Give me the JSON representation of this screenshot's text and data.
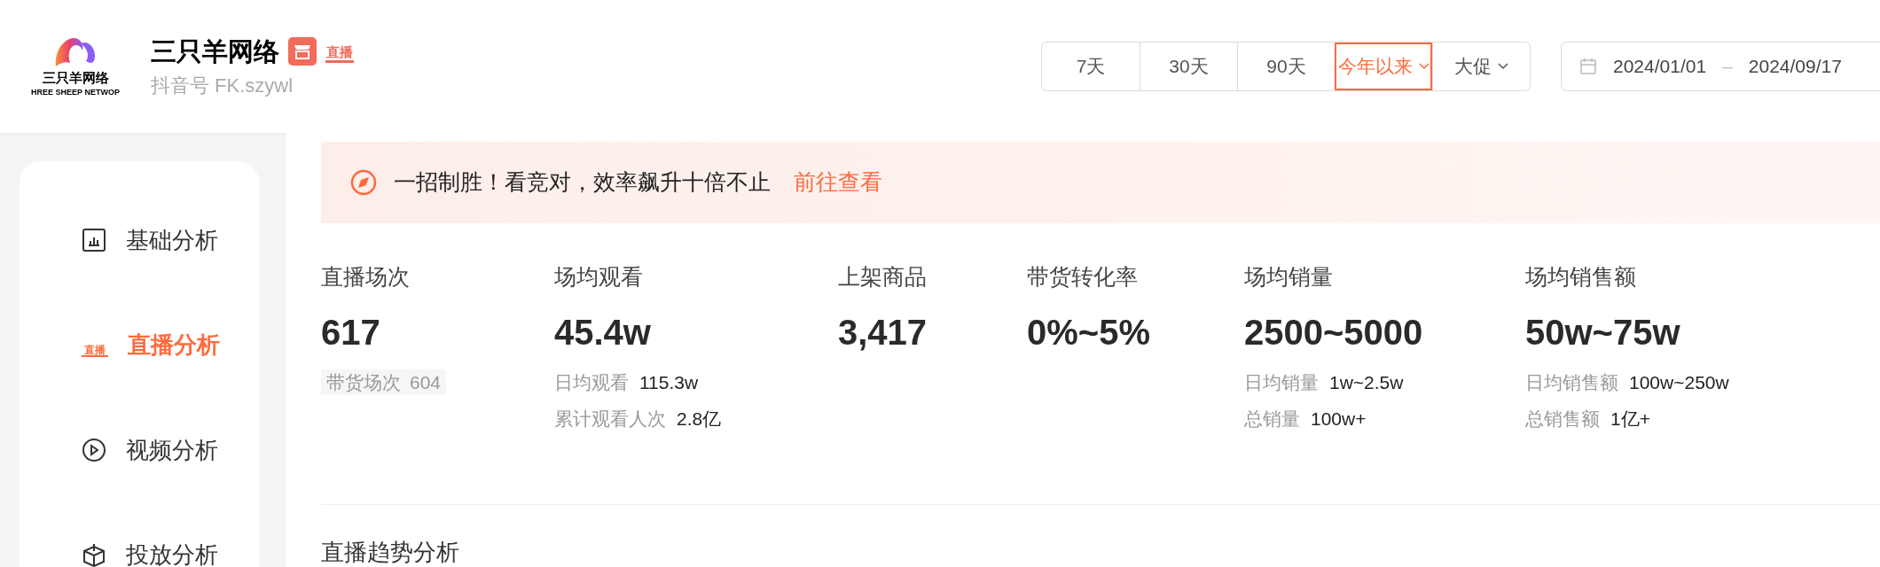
{
  "header": {
    "logo": {
      "text": "三只羊网络",
      "subtext": "HREE SHEEP NETWOP"
    },
    "name": "三只羊网络",
    "live_badge": "直播",
    "account": "抖音号 FK.szywl"
  },
  "filters": [
    {
      "label": "7天",
      "selected": false,
      "dropdown": false
    },
    {
      "label": "30天",
      "selected": false,
      "dropdown": false
    },
    {
      "label": "90天",
      "selected": false,
      "dropdown": false
    },
    {
      "label": "今年以来",
      "selected": true,
      "dropdown": true
    },
    {
      "label": "大促",
      "selected": false,
      "dropdown": true
    }
  ],
  "date_range": {
    "start": "2024/01/01",
    "separator": "–",
    "end": "2024/09/17"
  },
  "sidebar": {
    "items": [
      {
        "label": "基础分析",
        "selected": false,
        "kind": "chart"
      },
      {
        "label": "直播分析",
        "selected": true,
        "kind": "live",
        "icon_text": "直播"
      },
      {
        "label": "视频分析",
        "selected": false,
        "kind": "play"
      },
      {
        "label": "投放分析",
        "selected": false,
        "kind": "box"
      }
    ]
  },
  "banner": {
    "text": "一招制胜！看竞对，效率飙升十倍不止",
    "link": "前往查看"
  },
  "stats": [
    {
      "label": "直播场次",
      "value": "617",
      "details": [
        {
          "kind": "chip",
          "label": "带货场次",
          "value": "604"
        }
      ]
    },
    {
      "label": "场均观看",
      "value": "45.4w",
      "details": [
        {
          "kind": "plain",
          "label": "日均观看",
          "value": "115.3w"
        },
        {
          "kind": "plain",
          "label": "累计观看人次",
          "value": "2.8亿"
        }
      ]
    },
    {
      "label": "上架商品",
      "value": "3,417"
    },
    {
      "label": "带货转化率",
      "value": "0%~5%"
    },
    {
      "label": "场均销量",
      "value": "2500~5000",
      "details": [
        {
          "kind": "plain",
          "label": "日均销量",
          "value": "1w~2.5w"
        },
        {
          "kind": "plain",
          "label": "总销量",
          "value": "100w+"
        }
      ]
    },
    {
      "label": "场均销售额",
      "value": "50w~75w",
      "details": [
        {
          "kind": "plain",
          "label": "日均销售额",
          "value": "100w~250w"
        },
        {
          "kind": "plain",
          "label": "总销售额",
          "value": "1亿+"
        }
      ]
    }
  ],
  "section_title": "直播趋势分析"
}
